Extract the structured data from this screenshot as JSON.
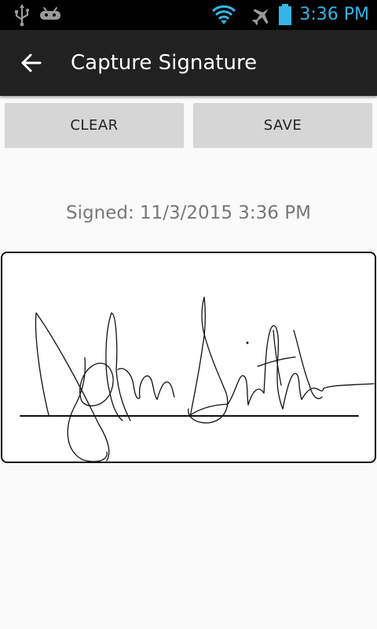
{
  "status_bar": {
    "time": "3:36 PM",
    "icons": [
      "usb-icon",
      "android-icon",
      "wifi-icon",
      "airplane-mode-icon",
      "battery-icon"
    ],
    "time_color": "#33b5e5"
  },
  "action_bar": {
    "title": "Capture Signature",
    "back_icon": "arrow-left-icon"
  },
  "buttons": {
    "clear_label": "CLEAR",
    "save_label": "SAVE"
  },
  "signature": {
    "signed_text": "Signed: 11/3/2015 3:36 PM"
  },
  "colors": {
    "background": "#fafafa",
    "action_bar": "#212121",
    "button": "#d6d6d6",
    "signed_text": "#777777"
  }
}
